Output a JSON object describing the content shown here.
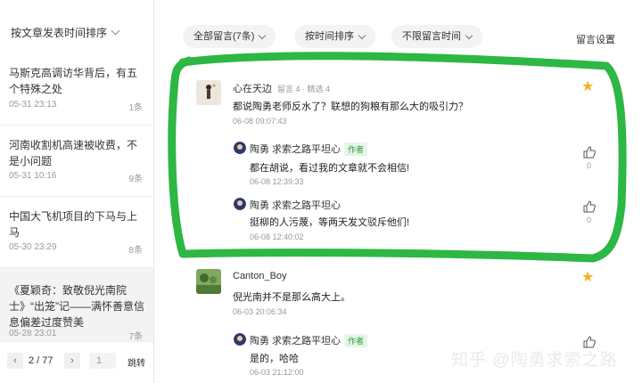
{
  "sidebar": {
    "sort_label": "按文章发表时间排序",
    "articles": [
      {
        "title": "马斯克高调访华背后，有五个特殊之处",
        "date": "05-31 23:13",
        "count": "1条"
      },
      {
        "title": "河南收割机高速被收费，不是小问题",
        "date": "05-31 10:16",
        "count": "9条"
      },
      {
        "title": "中国大飞机项目的下马与上马",
        "date": "05-30 23:29",
        "count": "8条"
      },
      {
        "title": "《夏颖奇：致敬倪光南院士》“出笼”记——满怀善意信息偏差过度赞美",
        "date": "05-28 23:01",
        "count": "7条"
      }
    ],
    "pager": {
      "prev": "‹",
      "info": "2 / 77",
      "next": "›",
      "input": "1",
      "jump": "跳转"
    }
  },
  "filters": {
    "all": "全部留言(7条)",
    "sort": "按时间排序",
    "time": "不限留言时间",
    "settings": "留言设置"
  },
  "comments": [
    {
      "user": "心在天边",
      "meta": "留言 4 · 精选 4",
      "text": "都说陶勇老师反水了？联想的狗粮有那么大的吸引力？",
      "time": "06-08 09:07:43"
    },
    {
      "user": "Canton_Boy",
      "text": "倪光南并不是那么高大上。",
      "time": "06-03 20:06:34"
    }
  ],
  "replies": [
    {
      "user": "陶勇 求索之路平坦心",
      "badge": "作者",
      "text": "都在胡说，看过我的文章就不会相信!",
      "time": "06-08 12:39:33",
      "likes": "0"
    },
    {
      "user": "陶勇 求索之路平坦心",
      "badge": "作者",
      "text": "挺柳的人污蔑，等两天发文驳斥他们!",
      "time": "06-08 12:40:02",
      "likes": "0"
    },
    {
      "user": "陶勇 求索之路平坦心",
      "badge": "作者",
      "text": "是的，哈哈",
      "time": "06-03 21:12:00"
    }
  ],
  "watermark": "知乎 @陶勇求索之路",
  "colors": {
    "author_green": "#2a9d3d",
    "star": "#f2b21e",
    "annotation": "#22b33a"
  }
}
